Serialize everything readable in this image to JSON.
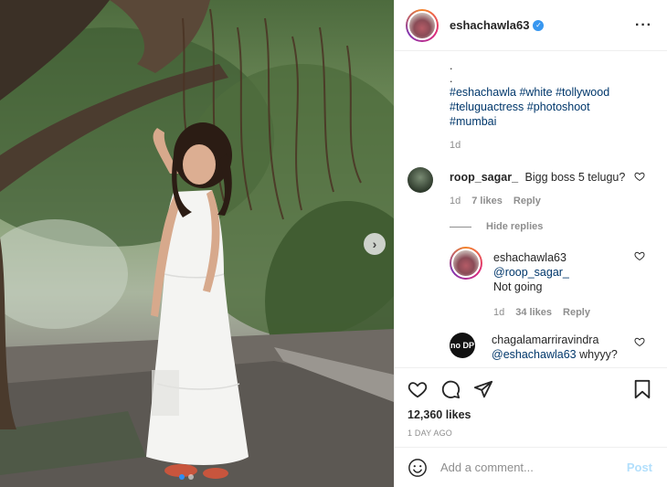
{
  "post": {
    "username": "eshachawla63",
    "verified_icon": "verified-badge-icon",
    "more_icon": "more-options-icon"
  },
  "caption": {
    "dots": [
      ".",
      "."
    ],
    "hashtags_line1": [
      "#eshachawla",
      "#white",
      "#tollywood"
    ],
    "hashtags_line2": [
      "#teluguactress",
      "#photoshoot"
    ],
    "hashtags_line3": [
      "#mumbai"
    ],
    "age": "1d"
  },
  "comments": [
    {
      "user": "roop_sagar_",
      "text": "Bigg boss 5 telugu?",
      "age": "1d",
      "likes": "7 likes",
      "reply_label": "Reply"
    }
  ],
  "hide_replies_label": "Hide replies",
  "replies": [
    {
      "user": "eshachawla63",
      "mention": "@roop_sagar_",
      "text": "Not going",
      "age": "1d",
      "likes": "34 likes",
      "reply_label": "Reply"
    },
    {
      "user": "chagalamarriravindra",
      "mention": "@eshachawla63",
      "text": "whyyy?",
      "avatar_text": "no DP"
    }
  ],
  "actions": {
    "like_icon": "heart-icon",
    "comment_icon": "comment-icon",
    "share_icon": "share-icon",
    "save_icon": "bookmark-icon",
    "likes_count": "12,360 likes",
    "posted_ago": "1 DAY AGO"
  },
  "add_comment": {
    "emoji_icon": "emoji-icon",
    "placeholder": "Add a comment...",
    "post_label": "Post"
  },
  "carousel": {
    "next_icon": "chevron-right-icon",
    "slides_count": 2,
    "active_index": 0
  },
  "colors": {
    "link": "#00376b",
    "verified": "#3897f0",
    "muted": "#8e8e8e",
    "post_disabled": "#b2dffc"
  }
}
